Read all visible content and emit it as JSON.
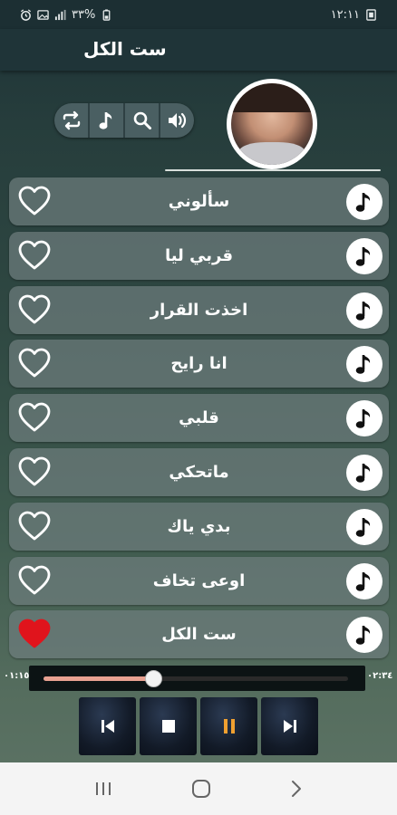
{
  "status": {
    "battery": "٣٣%",
    "time": "١٢:١١"
  },
  "header": {
    "title": "ست الكل"
  },
  "toolbar": {
    "icons": [
      "repeat-icon",
      "music-note-icon",
      "search-icon",
      "volume-icon"
    ]
  },
  "songs": [
    {
      "title": "سألوني",
      "favorite": false
    },
    {
      "title": "قربي ليا",
      "favorite": false
    },
    {
      "title": "اخذت القرار",
      "favorite": false
    },
    {
      "title": "انا رايح",
      "favorite": false
    },
    {
      "title": "قلبي",
      "favorite": false
    },
    {
      "title": "ماتحكي",
      "favorite": false
    },
    {
      "title": "بدي ياك",
      "favorite": false
    },
    {
      "title": "اوعى تخاف",
      "favorite": false
    },
    {
      "title": "ست الكل",
      "favorite": true
    }
  ],
  "player": {
    "elapsed": "٠١:١٥",
    "duration": "٠٢:٣٤",
    "progress": 0.36
  },
  "colors": {
    "heart_active": "#e0141c",
    "progress": "#e8a191",
    "pause_icon": "#f0a030"
  }
}
